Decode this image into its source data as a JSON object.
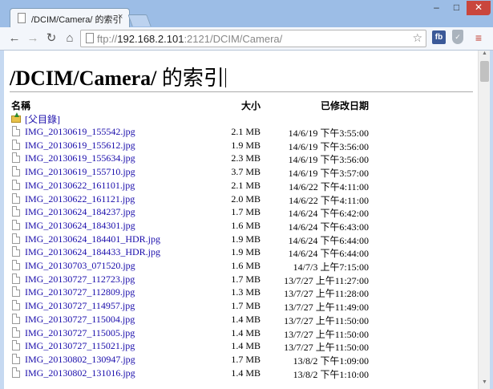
{
  "browser": {
    "tab_title": "/DCIM/Camera/ 的索引",
    "tab_close": "×",
    "url_scheme": "ftp://",
    "url_host": "192.168.2.101",
    "url_rest": ":2121/DCIM/Camera/",
    "ext_fb_label": "fb",
    "win_min": "–",
    "win_max": "□",
    "win_close": "✕"
  },
  "page": {
    "title_path": "/DCIM/Camera/",
    "title_suffix": " 的索引",
    "columns": {
      "name": "名稱",
      "size": "大小",
      "modified": "已修改日期"
    },
    "parent_label": "[父目錄]",
    "files": [
      {
        "name": "IMG_20130619_155542.jpg",
        "size": "2.1 MB",
        "date": "14/6/19 下午3:55:00"
      },
      {
        "name": "IMG_20130619_155612.jpg",
        "size": "1.9 MB",
        "date": "14/6/19 下午3:56:00"
      },
      {
        "name": "IMG_20130619_155634.jpg",
        "size": "2.3 MB",
        "date": "14/6/19 下午3:56:00"
      },
      {
        "name": "IMG_20130619_155710.jpg",
        "size": "3.7 MB",
        "date": "14/6/19 下午3:57:00"
      },
      {
        "name": "IMG_20130622_161101.jpg",
        "size": "2.1 MB",
        "date": "14/6/22 下午4:11:00"
      },
      {
        "name": "IMG_20130622_161121.jpg",
        "size": "2.0 MB",
        "date": "14/6/22 下午4:11:00"
      },
      {
        "name": "IMG_20130624_184237.jpg",
        "size": "1.7 MB",
        "date": "14/6/24 下午6:42:00"
      },
      {
        "name": "IMG_20130624_184301.jpg",
        "size": "1.6 MB",
        "date": "14/6/24 下午6:43:00"
      },
      {
        "name": "IMG_20130624_184401_HDR.jpg",
        "size": "1.9 MB",
        "date": "14/6/24 下午6:44:00"
      },
      {
        "name": "IMG_20130624_184433_HDR.jpg",
        "size": "1.9 MB",
        "date": "14/6/24 下午6:44:00"
      },
      {
        "name": "IMG_20130703_071520.jpg",
        "size": "1.6 MB",
        "date": "14/7/3 上午7:15:00"
      },
      {
        "name": "IMG_20130727_112723.jpg",
        "size": "1.7 MB",
        "date": "13/7/27 上午11:27:00"
      },
      {
        "name": "IMG_20130727_112809.jpg",
        "size": "1.3 MB",
        "date": "13/7/27 上午11:28:00"
      },
      {
        "name": "IMG_20130727_114957.jpg",
        "size": "1.7 MB",
        "date": "13/7/27 上午11:49:00"
      },
      {
        "name": "IMG_20130727_115004.jpg",
        "size": "1.4 MB",
        "date": "13/7/27 上午11:50:00"
      },
      {
        "name": "IMG_20130727_115005.jpg",
        "size": "1.4 MB",
        "date": "13/7/27 上午11:50:00"
      },
      {
        "name": "IMG_20130727_115021.jpg",
        "size": "1.4 MB",
        "date": "13/7/27 上午11:50:00"
      },
      {
        "name": "IMG_20130802_130947.jpg",
        "size": "1.7 MB",
        "date": "13/8/2 下午1:09:00"
      },
      {
        "name": "IMG_20130802_131016.jpg",
        "size": "1.4 MB",
        "date": "13/8/2 下午1:10:00"
      }
    ]
  }
}
